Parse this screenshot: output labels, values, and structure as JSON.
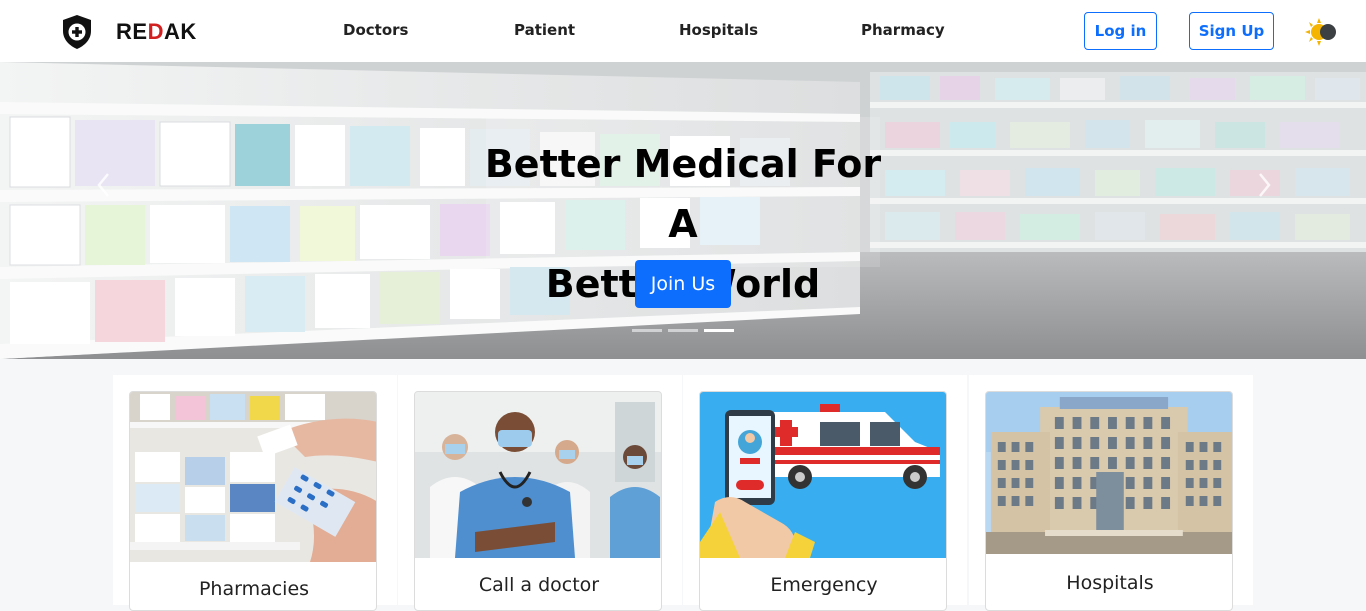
{
  "brand": {
    "part1": "RE",
    "part2": "D",
    "part3": "AK",
    "accent_color": "#d21f1f"
  },
  "nav": {
    "links": [
      {
        "label": "Doctors"
      },
      {
        "label": "Patient"
      },
      {
        "label": "Hospitals"
      },
      {
        "label": "Pharmacy"
      }
    ],
    "login_label": "Log in",
    "signup_label": "Sign Up",
    "theme_icon": "sun-moon-toggle-icon"
  },
  "hero": {
    "title_line1": "Better Medical For A",
    "title_line2": "Better World",
    "cta_label": "Join Us",
    "slide_count": 3,
    "active_slide": 3
  },
  "cards": [
    {
      "title": "Pharmacies",
      "image": "pharmacy-shelf-image"
    },
    {
      "title": "Call a doctor",
      "image": "doctors-team-image"
    },
    {
      "title": "Emergency",
      "image": "ambulance-phone-image"
    },
    {
      "title": "Hospitals",
      "image": "hospital-building-image"
    }
  ],
  "colors": {
    "primary": "#0d6efd",
    "text": "#222222"
  }
}
